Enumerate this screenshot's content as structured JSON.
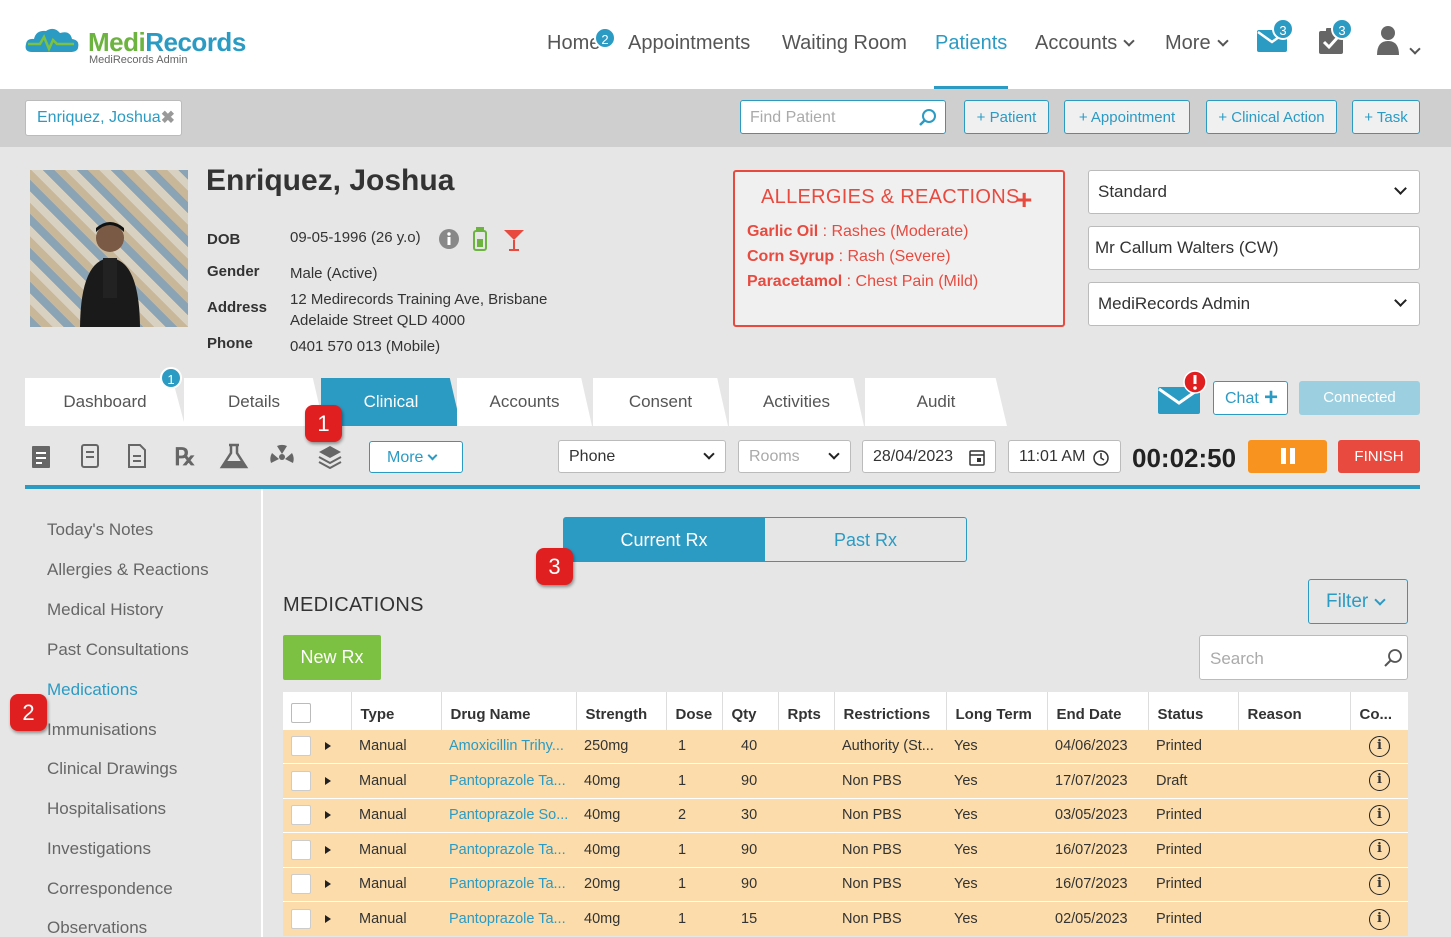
{
  "brand": {
    "name_part1": "Medi",
    "name_part2": "Records",
    "sub": "MediRecords Admin"
  },
  "nav": {
    "home": "Home",
    "home_badge": "2",
    "appointments": "Appointments",
    "waiting_room": "Waiting Room",
    "patients": "Patients",
    "accounts": "Accounts",
    "more": "More",
    "mail_badge": "3",
    "tasks_badge": "3"
  },
  "patient_bar": {
    "tab_label": "Enriquez, Joshua",
    "find_placeholder": "Find Patient",
    "buttons": [
      "+ Patient",
      "+ Appointment",
      "+ Clinical Action",
      "+ Task"
    ]
  },
  "patient": {
    "name": "Enriquez, Joshua",
    "dob_label": "DOB",
    "dob": "09-05-1996 (26 y.o)",
    "gender_label": "Gender",
    "gender": "Male (Active)",
    "address_label": "Address",
    "address_line1": "12 Medirecords Training Ave, Brisbane",
    "address_line2": "Adelaide Street QLD 4000",
    "phone_label": "Phone",
    "phone": "0401 570 013 (Mobile)"
  },
  "allergies": {
    "title": "ALLERGIES & REACTIONS",
    "items": [
      {
        "name": "Garlic Oil",
        "reaction": " : Rashes (Moderate)"
      },
      {
        "name": "Corn Syrup",
        "reaction": " : Rash (Severe)"
      },
      {
        "name": "Paracetamol",
        "reaction": " : Chest Pain (Mild)"
      }
    ]
  },
  "right_selects": {
    "template": "Standard",
    "practitioner": "Mr Callum Walters (CW)",
    "location": "MediRecords Admin"
  },
  "tabs": {
    "items": [
      "Dashboard",
      "Details",
      "Clinical",
      "Accounts",
      "Consent",
      "Activities",
      "Audit"
    ],
    "dashboard_badge": "1",
    "active": "Clinical"
  },
  "chat": {
    "label": "Chat",
    "connected": "Connected"
  },
  "toolbar": {
    "more": "More",
    "mode": "Phone",
    "rooms": "Rooms",
    "date": "28/04/2023",
    "time": "11:01 AM",
    "timer": "00:02:50",
    "finish": "FINISH"
  },
  "sidebar": {
    "items": [
      "Today's Notes",
      "Allergies & Reactions",
      "Medical History",
      "Past Consultations",
      "Medications",
      "Immunisations",
      "Clinical Drawings",
      "Hospitalisations",
      "Investigations",
      "Correspondence",
      "Observations"
    ],
    "active": "Medications"
  },
  "rx_toggle": {
    "current": "Current Rx",
    "past": "Past Rx"
  },
  "medications": {
    "title": "MEDICATIONS",
    "new_rx": "New Rx",
    "filter": "Filter",
    "search_placeholder": "Search",
    "columns": [
      "Type",
      "Drug Name",
      "Strength",
      "Dose",
      "Qty",
      "Rpts",
      "Restrictions",
      "Long Term",
      "End Date",
      "Status",
      "Reason",
      "Co..."
    ],
    "rows": [
      [
        "Manual",
        "Amoxicillin Trihy...",
        "250mg",
        "1",
        "40",
        "",
        "Authority (St...",
        "Yes",
        "04/06/2023",
        "Printed",
        ""
      ],
      [
        "Manual",
        "Pantoprazole Ta...",
        "40mg",
        "1",
        "90",
        "",
        "Non PBS",
        "Yes",
        "17/07/2023",
        "Draft",
        ""
      ],
      [
        "Manual",
        "Pantoprazole So...",
        "40mg",
        "2",
        "30",
        "",
        "Non PBS",
        "Yes",
        "03/05/2023",
        "Printed",
        ""
      ],
      [
        "Manual",
        "Pantoprazole Ta...",
        "40mg",
        "1",
        "90",
        "",
        "Non PBS",
        "Yes",
        "16/07/2023",
        "Printed",
        ""
      ],
      [
        "Manual",
        "Pantoprazole Ta...",
        "20mg",
        "1",
        "90",
        "",
        "Non PBS",
        "Yes",
        "16/07/2023",
        "Printed",
        ""
      ],
      [
        "Manual",
        "Pantoprazole Ta...",
        "40mg",
        "1",
        "15",
        "",
        "Non PBS",
        "Yes",
        "02/05/2023",
        "Printed",
        ""
      ]
    ]
  },
  "callouts": [
    "1",
    "2",
    "3"
  ],
  "colors": {
    "accent": "#2b9bc4",
    "green": "#7cc142",
    "alert": "#e84a3f",
    "row_bg": "#fbdcaa",
    "pause": "#f7931e"
  }
}
